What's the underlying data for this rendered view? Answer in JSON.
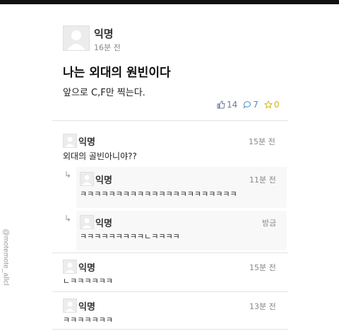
{
  "post": {
    "author": "익명",
    "time": "16분 전",
    "title": "나는 외대의 원빈이다",
    "body": "앞으로 C,F만 찍는다.",
    "likes": "14",
    "comments": "7",
    "scraps": "0"
  },
  "comments": [
    {
      "author": "익명",
      "time": "15분 전",
      "text": "외대의 골빈아니야??"
    },
    {
      "author": "익명",
      "time": "11분 전",
      "text": "ㅋㅋㅋㅋㅋㅋㅋㅋㅋㅋㅋㅋㅋㅋㅋㅋㅋㅋㅋㅋㅋㅋ"
    },
    {
      "author": "익명",
      "time": "방금",
      "text": "ㅋㅋㅋㅋㅋㅋㅋㅋㅋㄴㅋㅋㅋㅋ"
    },
    {
      "author": "익명",
      "time": "15분 전",
      "text": "ㄴㅋㅋㅋㅋㅋㅋ"
    },
    {
      "author": "익명",
      "time": "13분 전",
      "text": "ㅋㅋㅋㅋㅋㅋㅋ"
    }
  ],
  "watermark": "@motemote_allcl",
  "icons": {
    "like": "thumbs-up-icon",
    "comment": "comment-bubble-icon",
    "scrap": "star-icon",
    "reply": "reply-arrow-icon"
  },
  "colors": {
    "like": "#6b7a99",
    "comment": "#4a90c8",
    "scrap": "#d8b800"
  }
}
